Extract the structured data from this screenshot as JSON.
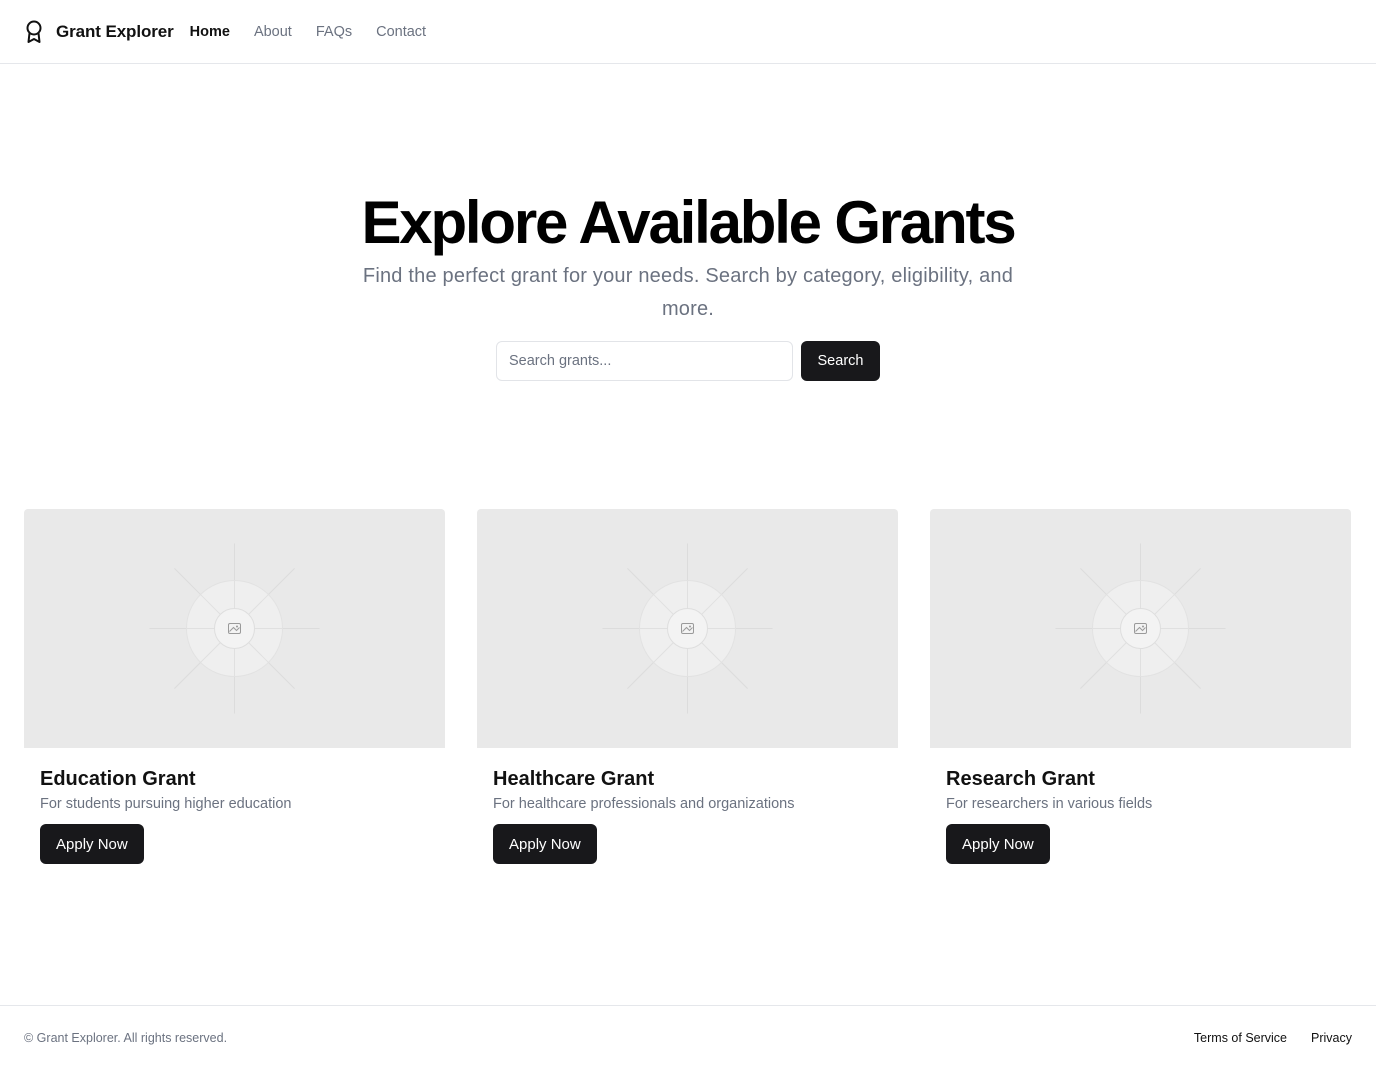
{
  "header": {
    "brand_name": "Grant Explorer",
    "brand_icon": "award-icon",
    "nav": [
      {
        "label": "Home",
        "active": true
      },
      {
        "label": "About",
        "active": false
      },
      {
        "label": "FAQs",
        "active": false
      },
      {
        "label": "Contact",
        "active": false
      }
    ]
  },
  "hero": {
    "title": "Explore Available Grants",
    "subtitle": "Find the perfect grant for your needs. Search by category, eligibility, and more.",
    "search": {
      "placeholder": "Search grants...",
      "value": "",
      "button_label": "Search"
    }
  },
  "cards": [
    {
      "image": "image-placeholder-icon",
      "title": "Education Grant",
      "description": "For students pursuing higher education",
      "button_label": "Apply Now"
    },
    {
      "image": "image-placeholder-icon",
      "title": "Healthcare Grant",
      "description": "For healthcare professionals and organizations",
      "button_label": "Apply Now"
    },
    {
      "image": "image-placeholder-icon",
      "title": "Research Grant",
      "description": "For researchers in various fields",
      "button_label": "Apply Now"
    }
  ],
  "footer": {
    "copyright": "© Grant Explorer. All rights reserved.",
    "links": [
      "Terms of Service",
      "Privacy"
    ]
  },
  "colors": {
    "primary_button": "#18181b",
    "muted_text": "#6b7280",
    "border": "#e5e7eb",
    "placeholder_bg": "#e9e9e9"
  }
}
